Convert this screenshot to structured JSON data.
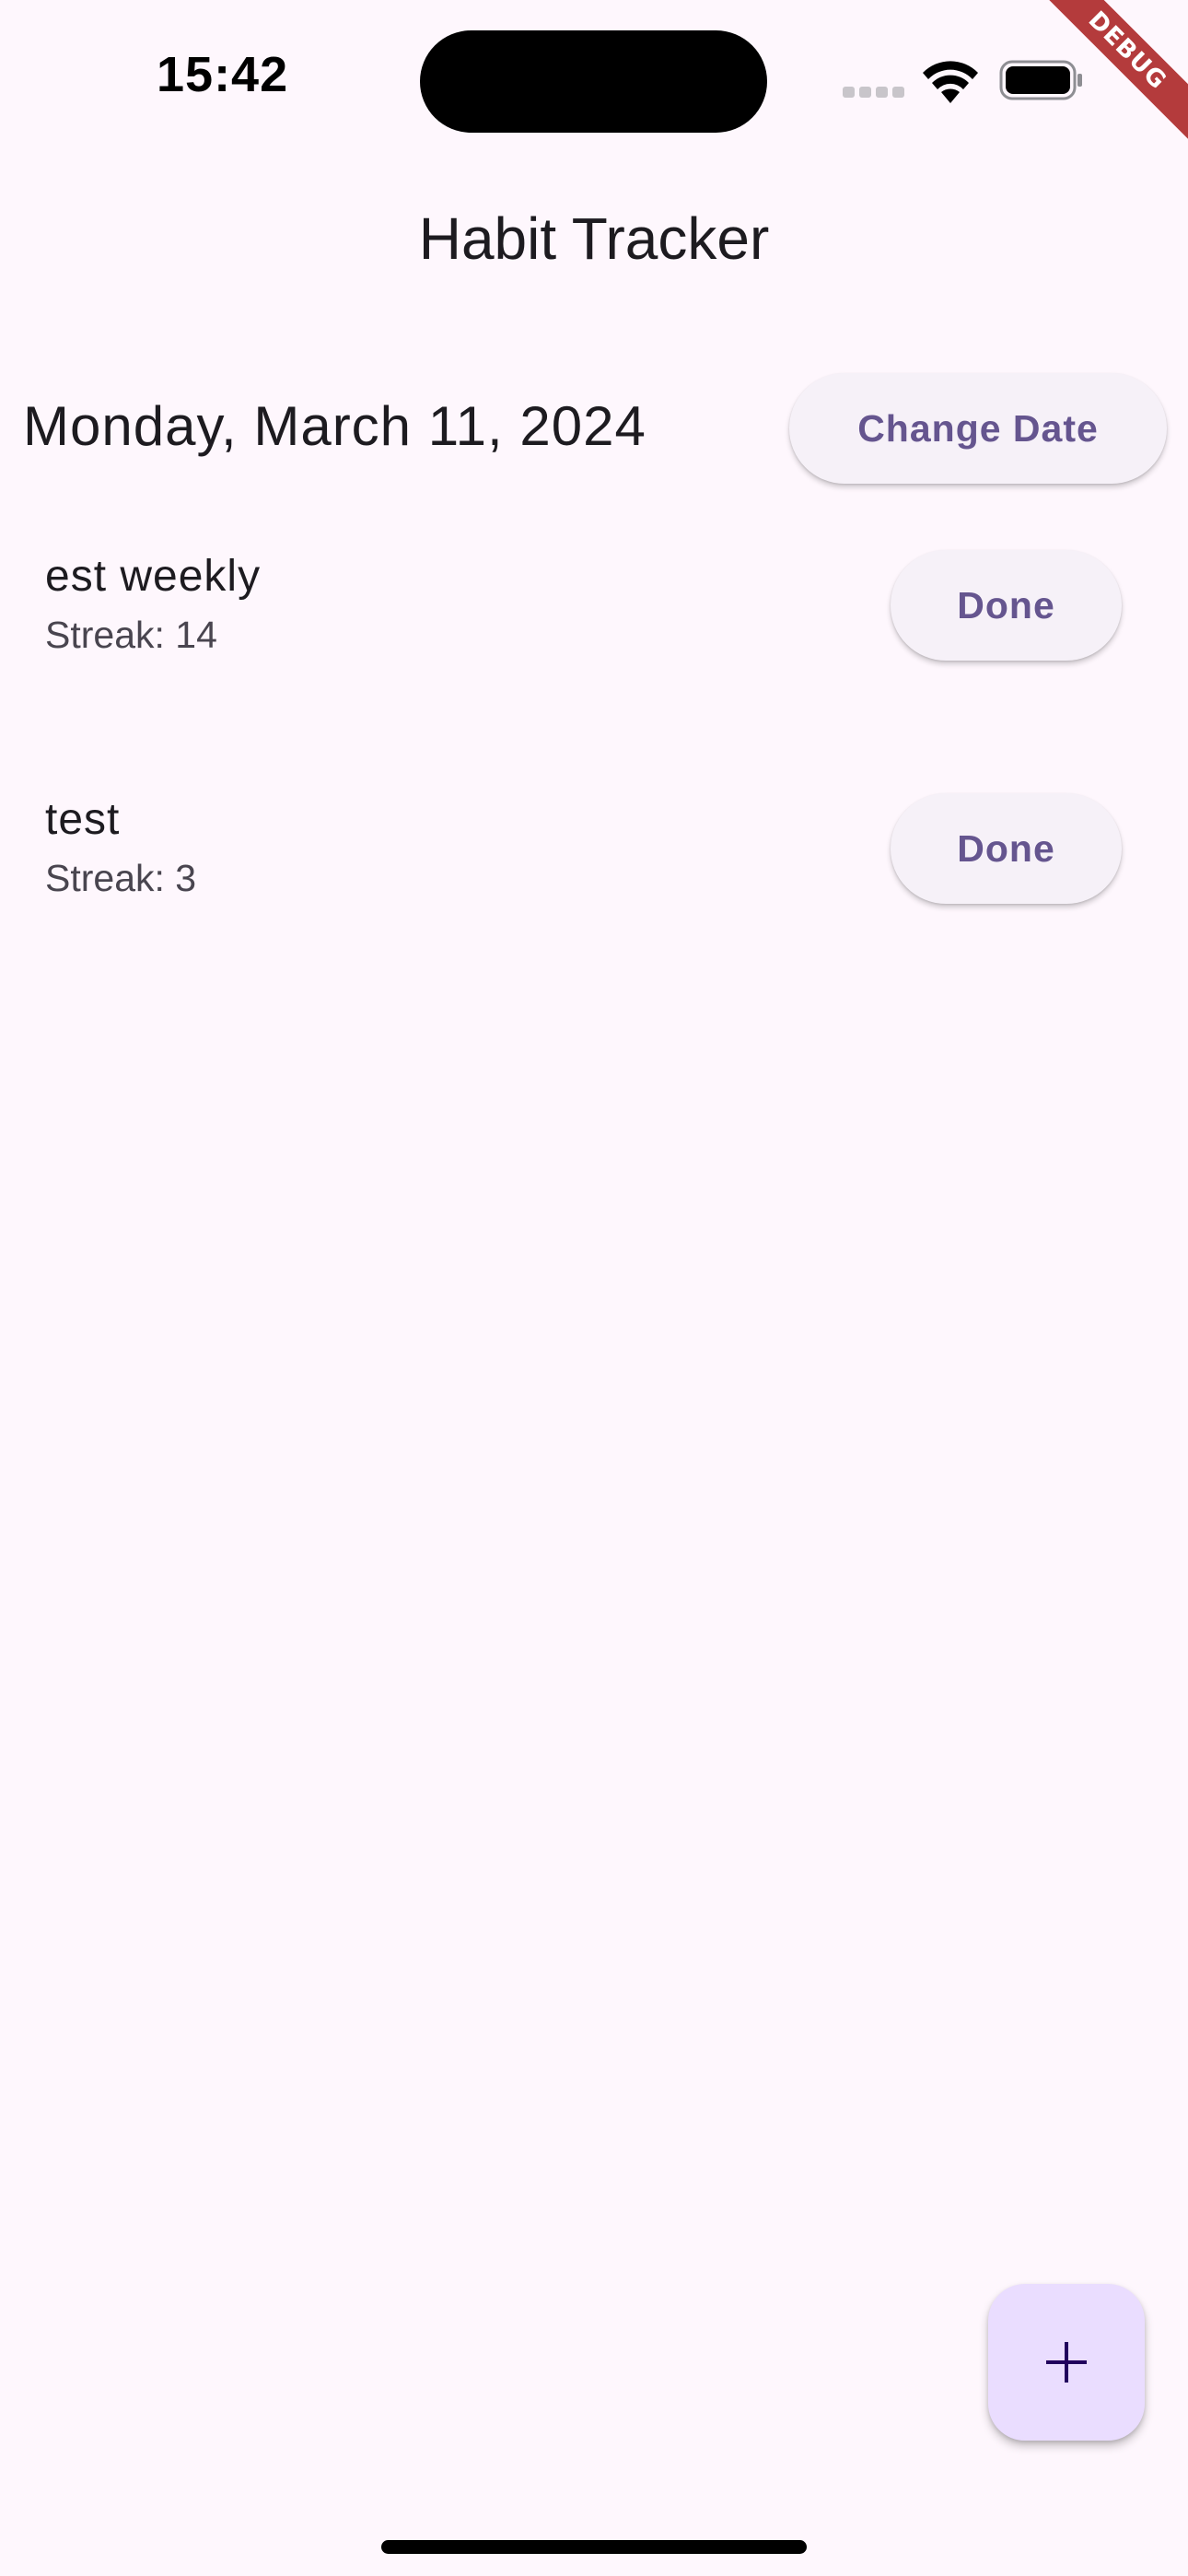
{
  "status_bar": {
    "time": "15:42",
    "icons": [
      "signal-icon",
      "wifi-icon",
      "battery-icon"
    ]
  },
  "debug_banner": "DEBUG",
  "app_bar": {
    "title": "Habit Tracker"
  },
  "date_header": {
    "date": "Monday, March 11, 2024",
    "change_date_label": "Change Date"
  },
  "habits": [
    {
      "name": "est weekly",
      "streak": "Streak: 14",
      "action_label": "Done"
    },
    {
      "name": "test",
      "streak": "Streak: 3",
      "action_label": "Done"
    }
  ],
  "fab": {
    "icon": "plus-icon"
  },
  "colors": {
    "background": "#fef7fd",
    "button_bg": "#f6f1f8",
    "button_text": "#65558f",
    "fab_bg": "#eaddff",
    "fab_icon": "#21005d",
    "debug_banner": "#b43b3c"
  }
}
